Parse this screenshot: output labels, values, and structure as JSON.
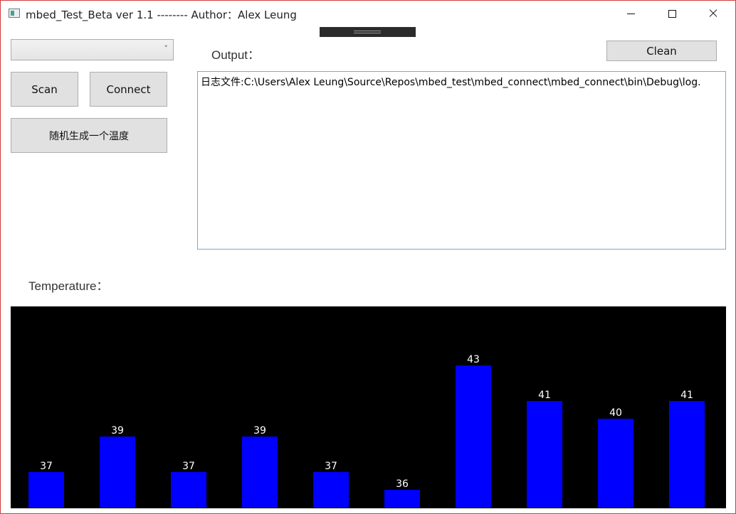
{
  "window": {
    "title": "mbed_Test_Beta ver 1.1 -------- Author：Alex Leung"
  },
  "controls": {
    "port_select_value": "",
    "scan_label": "Scan",
    "connect_label": "Connect",
    "random_label": "随机生成一个温度",
    "clean_label": "Clean"
  },
  "output": {
    "label": "Output：",
    "text": "日志文件:C:\\Users\\Alex Leung\\Source\\Repos\\mbed_test\\mbed_connect\\mbed_connect\\bin\\Debug\\log."
  },
  "temperature": {
    "label": "Temperature："
  },
  "colors": {
    "bar": "#0000ff",
    "chart_bg": "#000000",
    "value_label": "#ffffff"
  },
  "chart_data": {
    "type": "bar",
    "categories": [
      "",
      "",
      "",
      "",
      "",
      "",
      "",
      "",
      "",
      ""
    ],
    "values": [
      37,
      39,
      37,
      39,
      37,
      36,
      43,
      41,
      40,
      41
    ],
    "title": "",
    "xlabel": "",
    "ylabel": "",
    "grid": false
  }
}
